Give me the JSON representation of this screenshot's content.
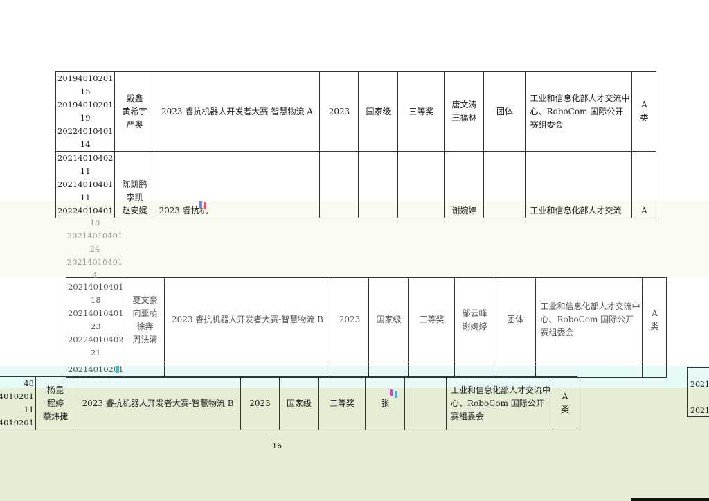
{
  "rows": [
    {
      "ids": "20194010201\n15\n20194010201\n19\n20224010401\n14",
      "names": "戴鑫\n黄希宇\n严奥",
      "competition": "2023 睿抗机器人开发者大赛-智慧物流 A",
      "year": "2023",
      "level": "国家级",
      "award": "三等奖",
      "teachers": "唐文涛\n王福林",
      "type": "团体",
      "organizer": "工业和信息化部人才交流中心、RoboCom 国际公开赛组委会",
      "category": "A\n类"
    },
    {
      "ids": "20214010402\n11\n20214010401\n11\n20224010401",
      "names": "陈凯鹏\n李凯\n赵安娓",
      "competition": "2023 睿抗机",
      "year": "",
      "level": "",
      "award": "",
      "teachers": "谢婉婷",
      "type": "",
      "organizer": "工业和信息化部人才交流",
      "category": "A"
    },
    {
      "ids": "18\n20214010401\n24\n20214010401\n4",
      "names": "",
      "competition": "",
      "year": "",
      "level": "",
      "award": "",
      "teachers": "",
      "type": "",
      "organizer": "",
      "category": ""
    },
    {
      "ids": "20214010401\n18\n20214010401\n23\n20224010402\n21",
      "names": "夏文豪\n向亚萌\n徐奔\n周法清",
      "competition": "2023 睿抗机器人开发者大赛-智慧物流 B",
      "year": "2023",
      "level": "国家级",
      "award": "三等奖",
      "teachers": "邹云峰\n谢婉婷",
      "type": "团体",
      "organizer": "工业和信息化部人才交流中心、RoboCom 国际公开赛组委会",
      "category": "A\n类"
    },
    {
      "ids": "20214010201",
      "names": "",
      "competition": "",
      "year": "",
      "level": "",
      "award": "",
      "teachers": "",
      "type": "",
      "organizer": "",
      "category": ""
    },
    {
      "ids": "48\n4010201\n11\n4010201",
      "names": "杨昆\n程婷\n蔡炜捷",
      "competition": "2023 睿抗机器人开发者大赛-智慧物流 B",
      "year": "2023",
      "level": "国家级",
      "award": "三等奖",
      "teachers": "张",
      "type": "",
      "organizer": "工业和信息化部人才交流中心、RoboCom 国际公开赛组委会",
      "category": "A\n类"
    }
  ],
  "edge_numbers": [
    "2021",
    "2021"
  ],
  "page_number": "16"
}
